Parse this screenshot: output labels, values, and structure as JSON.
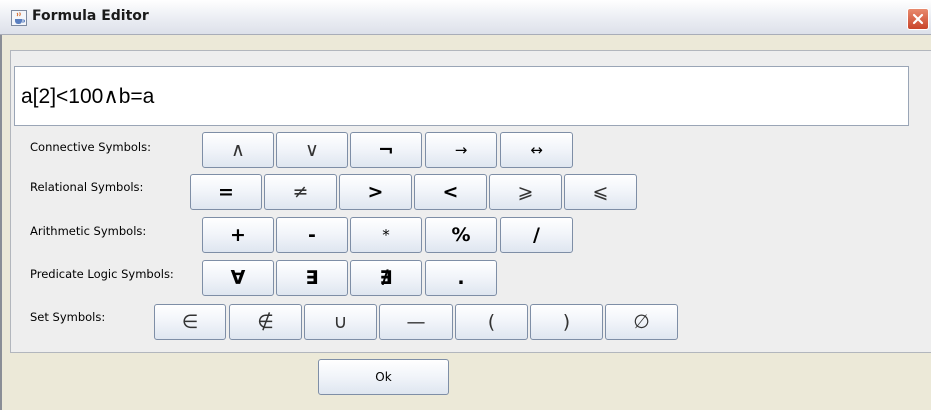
{
  "window": {
    "title": "Formula Editor",
    "icon": "java-cup-icon",
    "close_icon": "close-x-icon",
    "close_color": "#d5573b"
  },
  "formula": {
    "value": "a[2]<100∧b=a"
  },
  "rows": {
    "connective": {
      "label": "Connective Symbols:",
      "buttons": [
        "∧",
        "∨",
        "¬",
        "→",
        "↔"
      ]
    },
    "relational": {
      "label": "Relational Symbols:",
      "buttons": [
        "=",
        "≠",
        ">",
        "<",
        "⩾",
        "⩽"
      ]
    },
    "arithmetic": {
      "label": "Arithmetic Symbols:",
      "buttons": [
        "+",
        "-",
        "*",
        "%",
        "/"
      ]
    },
    "predicate": {
      "label": "Predicate Logic Symbols:",
      "buttons": [
        "∀",
        "∃",
        "∄",
        "."
      ]
    },
    "set": {
      "label": "Set Symbols:",
      "buttons": [
        "∈",
        "∉",
        "∪",
        "—",
        "(",
        ")",
        "∅"
      ]
    }
  },
  "ok_label": "Ok"
}
